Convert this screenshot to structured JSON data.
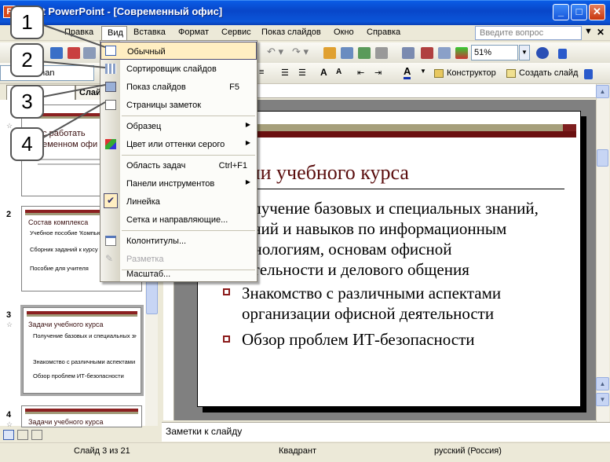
{
  "window": {
    "title": "osoft PowerPoint - [Современный офис]",
    "app_icon": "P"
  },
  "menubar": {
    "items": [
      "Правка",
      "Вид",
      "Вставка",
      "Формат",
      "Сервис",
      "Показ слайдов",
      "Окно",
      "Справка"
    ],
    "help_placeholder": "Введите вопрос"
  },
  "toolbar": {
    "zoom": "51%",
    "font": "w Roman",
    "designer": "Конструктор",
    "new_slide": "Создать слайд"
  },
  "tabs": {
    "slides": "Слай"
  },
  "view_menu": {
    "items": [
      {
        "label": "Обычный"
      },
      {
        "label": "Сортировщик слайдов"
      },
      {
        "label": "Показ слайдов",
        "shortcut": "F5"
      },
      {
        "label": "Страницы заметок"
      },
      {
        "label": "Образец",
        "submenu": true
      },
      {
        "label": "Цвет или оттенки серого",
        "submenu": true
      },
      {
        "label": "Область задач",
        "shortcut": "Ctrl+F1"
      },
      {
        "label": "Панели инструментов",
        "submenu": true
      },
      {
        "label": "Линейка",
        "checked": true
      },
      {
        "label": "Сетка и направляющие..."
      },
      {
        "label": "Колонтитулы..."
      },
      {
        "label": "Разметка",
        "disabled": true
      },
      {
        "label": "Масштаб..."
      }
    ]
  },
  "callouts": [
    "1",
    "2",
    "3",
    "4"
  ],
  "thumbnails": [
    {
      "number": "",
      "title_lines": [
        "ос работать",
        "ременном офи"
      ]
    },
    {
      "number": "2",
      "title": "Состав комплекса",
      "bullets": [
        "Учебное пособие 'Компьютер в современном офисе'",
        "Сборник заданий к курсу 'Компьютер в современном офисе'",
        "Пособие для учителя"
      ]
    },
    {
      "number": "3",
      "title": "Задачи учебного курса",
      "bullets": [
        "Получение базовых и специальных знаний, умений и навыков по информационным технологиям",
        "Знакомство с различными аспектами организации офисной деятельности",
        "Обзор проблем ИТ-безопасности"
      ]
    },
    {
      "number": "4",
      "title": "Задачи учебного курса"
    }
  ],
  "slide": {
    "title": "ачи учебного курса",
    "bullets": [
      [
        "олучение базовых и специальных знаний,",
        "ений и навыков по информационным",
        "хнологиям, основам офисной",
        "ятельности и делового общения"
      ],
      [
        "Знакомство с различными аспектами",
        "организации офисной деятельности"
      ],
      [
        "Обзор проблем ИТ-безопасности"
      ]
    ]
  },
  "notes_placeholder": "Заметки к слайду",
  "status": {
    "slide": "Слайд 3 из 21",
    "design": "Квадрант",
    "language": "русский (Россия)"
  }
}
